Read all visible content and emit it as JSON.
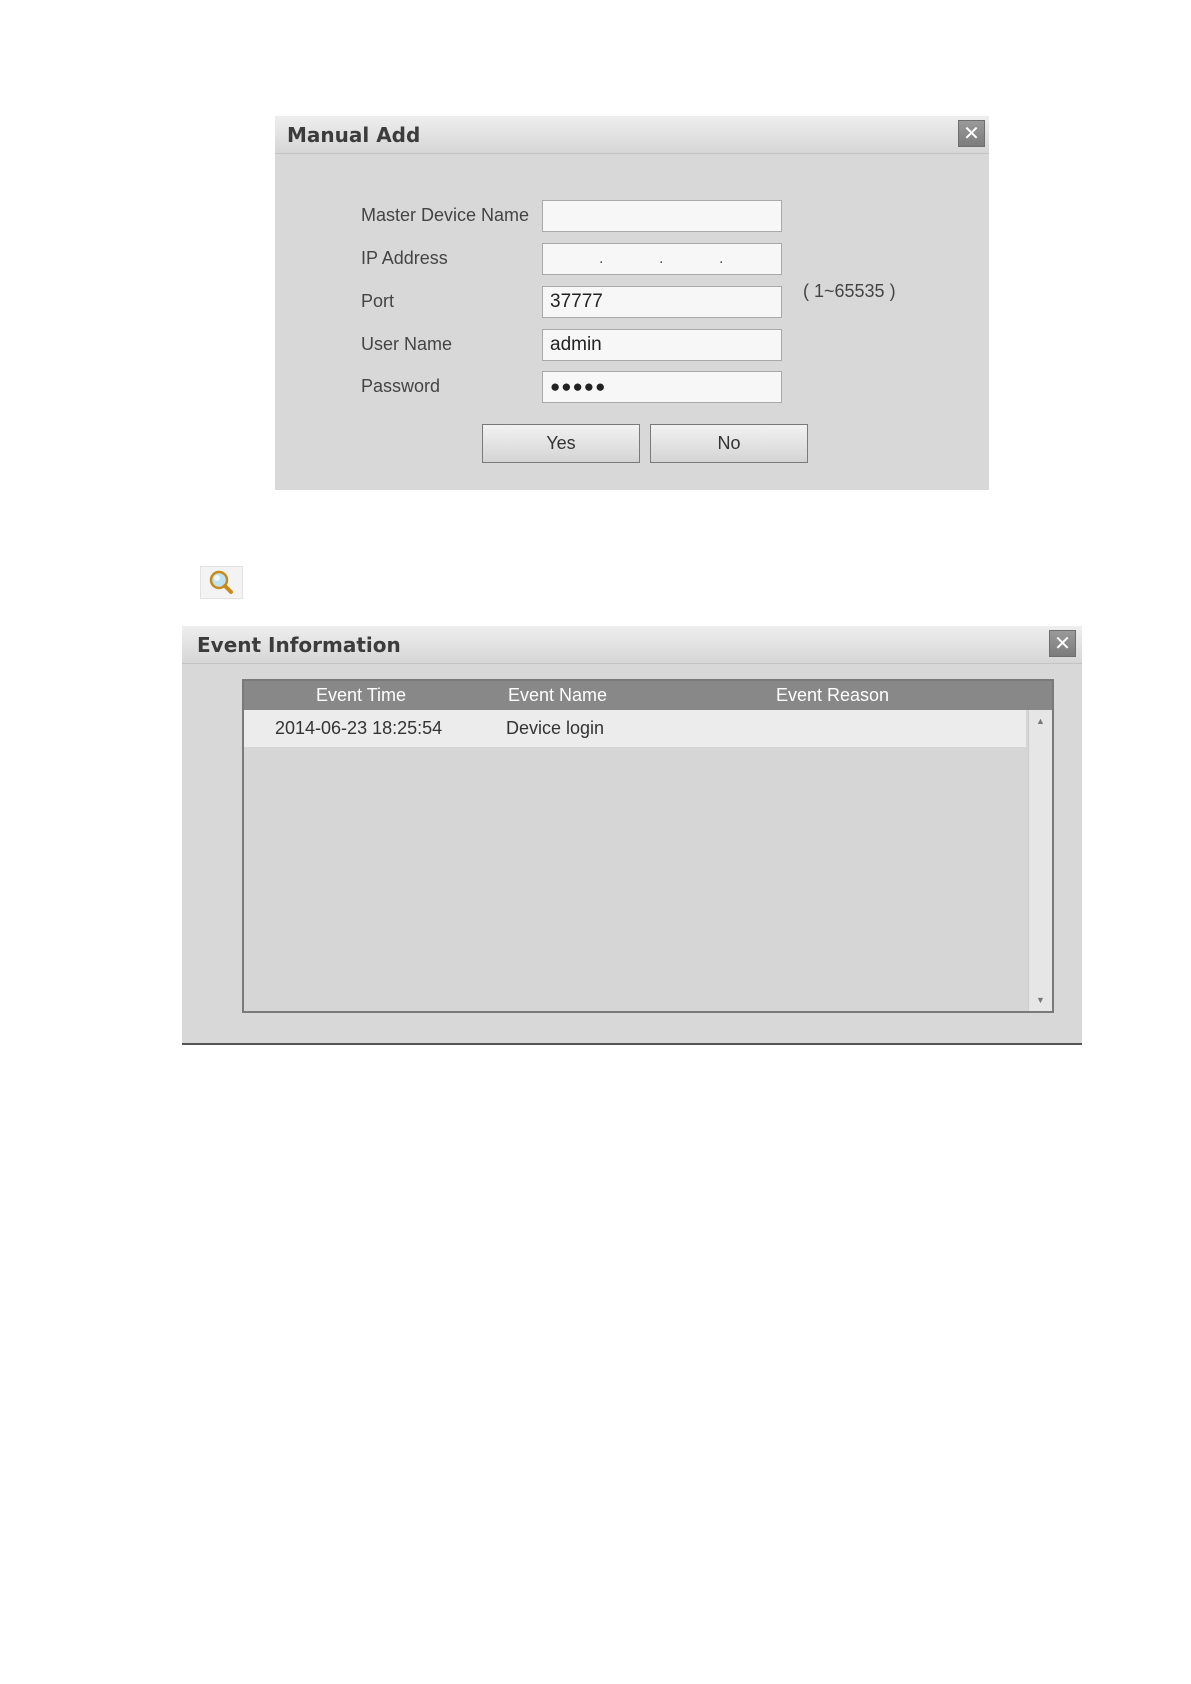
{
  "manual_add": {
    "title": "Manual Add",
    "close_symbol": "✕",
    "fields": {
      "master_device_name": {
        "label": "Master Device Name",
        "value": ""
      },
      "ip_address": {
        "label": "IP Address",
        "value": "",
        "separator": "."
      },
      "port": {
        "label": "Port",
        "value": "37777",
        "range_hint": "( 1~65535 )"
      },
      "user_name": {
        "label": "User Name",
        "value": "admin"
      },
      "password": {
        "label": "Password",
        "value": "●●●●●"
      }
    },
    "yes_label": "Yes",
    "no_label": "No"
  },
  "toolbar": {
    "search_icon": "search-icon"
  },
  "event_info": {
    "title": "Event Information",
    "close_symbol": "✕",
    "columns": [
      "Event Time",
      "Event Name",
      "Event Reason"
    ],
    "rows": [
      {
        "time": "2014-06-23 18:25:54",
        "name": "Device login",
        "reason": ""
      }
    ],
    "scroll_up": "▲",
    "scroll_down": "▼"
  }
}
